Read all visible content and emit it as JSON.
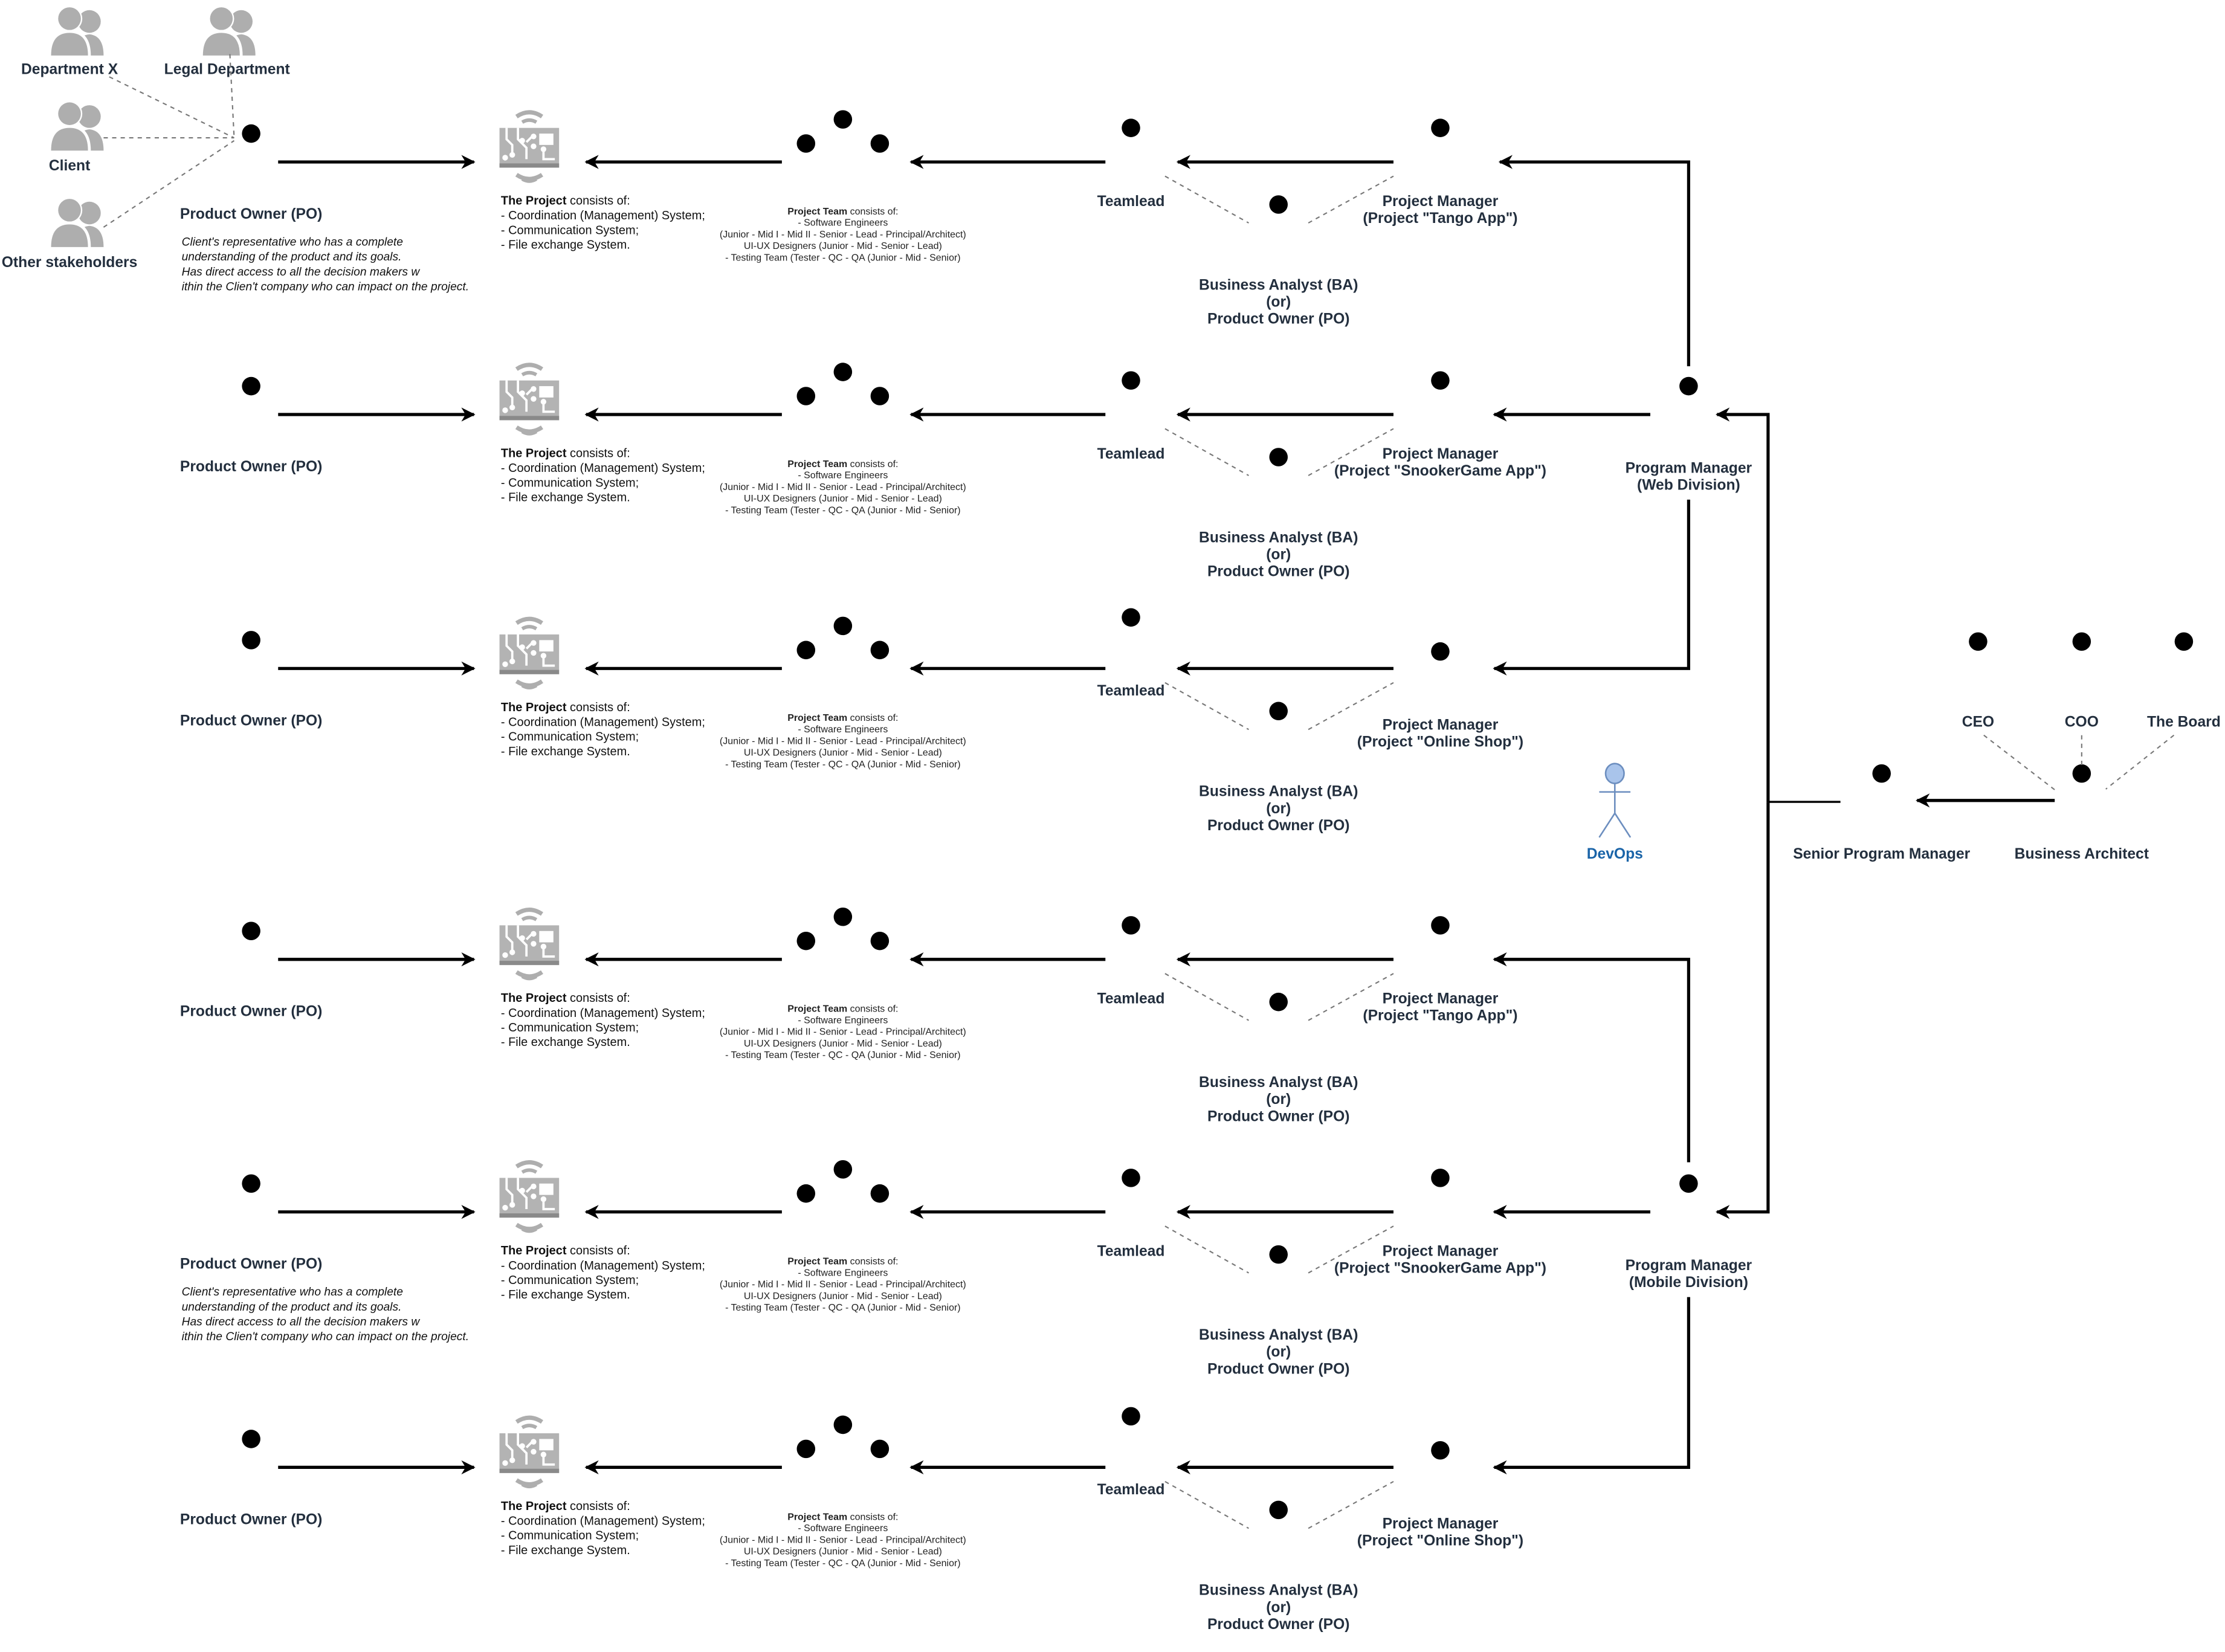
{
  "stakeholders": [
    {
      "label": "Department X",
      "icon": "user-group-icon"
    },
    {
      "label": "Legal Department",
      "icon": "user-group-icon"
    },
    {
      "label": "Client",
      "icon": "user-group-icon"
    },
    {
      "label": "Other stakeholders",
      "icon": "user-group-icon"
    }
  ],
  "labels": {
    "product_owner": "Product Owner (PO)",
    "teamlead": "Teamlead",
    "project_manager": "Project Manager",
    "ba_line1": "Business Analyst (BA)",
    "ba_line2": "(or)",
    "ba_line3": "Product Owner (PO)",
    "devops": "DevOps",
    "senior_program_manager": "Senior Program Manager",
    "business_architect": "Business Architect",
    "ceo": "CEO",
    "coo": "COO",
    "board": "The Board"
  },
  "po_description": [
    "Client's representative who has a complete",
    "understanding of the product and its goals.",
    "Has direct access to all the decision makers w",
    "ithin the Clien't company who can impact on the project."
  ],
  "project_box": {
    "title_bold": "The Project",
    "title_rest": " consists of:",
    "items": [
      "- Coordination (Management) System;",
      "- Communication System;",
      "- File exchange System."
    ],
    "icon": "circuit-board-icon"
  },
  "team_box": {
    "title_bold": "Project Team",
    "title_rest": " consists of:",
    "lines": [
      "- Software Engineers",
      "(Junior - Mid I - Mid II - Senior - Lead - Principal/Architect)",
      "UI-UX Designers (Junior - Mid - Senior - Lead)",
      "- Testing Team (Tester - QC - QA (Junior - Mid - Senior)"
    ]
  },
  "divisions": [
    {
      "program_manager": [
        "Program Manager",
        "(Web Division)"
      ],
      "projects": [
        {
          "name": "(Project \"Tango App\")",
          "po_has_description": true
        },
        {
          "name": "(Project \"SnookerGame App\")",
          "po_has_description": false
        },
        {
          "name": "(Project \"Online Shop\")",
          "po_has_description": false
        }
      ]
    },
    {
      "program_manager": [
        "Program Manager",
        "(Mobile Division)"
      ],
      "projects": [
        {
          "name": "(Project \"Tango App\")",
          "po_has_description": false
        },
        {
          "name": "(Project \"SnookerGame App\")",
          "po_has_description": true
        },
        {
          "name": "(Project \"Online Shop\")",
          "po_has_description": false
        }
      ]
    }
  ],
  "colors": {
    "actor_stroke": "#000000",
    "text": "#232f3e",
    "devops_fill": "#a9c4eb",
    "devops_stroke": "#6c8ebf",
    "devops_text": "#1a64a8",
    "stakeholder_icon": "#aeaeae",
    "dashed": "#777777"
  }
}
